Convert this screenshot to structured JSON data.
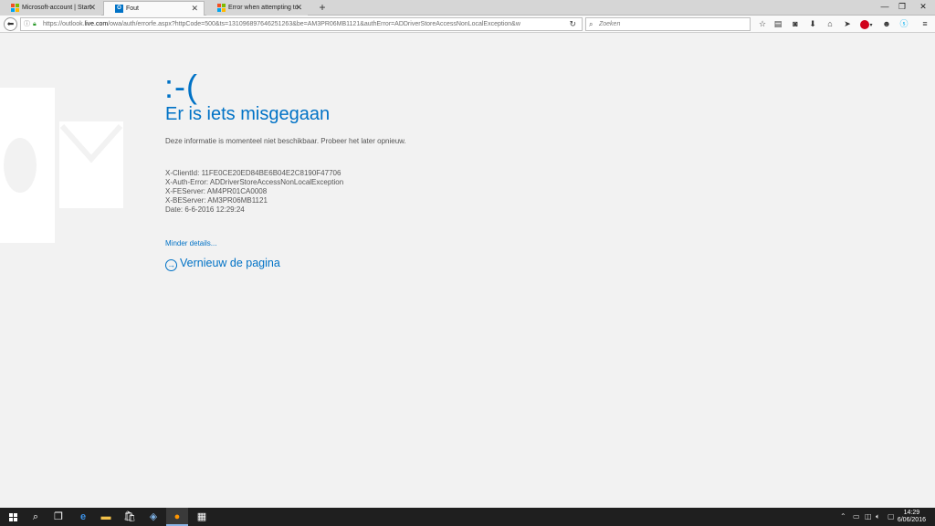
{
  "browser": {
    "tabs": [
      {
        "label": "Microsoft-account | Start",
        "active": false,
        "favicon": "microsoft-logo-icon"
      },
      {
        "label": "Fout",
        "active": true,
        "favicon": "outlook-icon"
      },
      {
        "label": "Error when attempting to ...",
        "active": false,
        "favicon": "microsoft-logo-icon"
      }
    ],
    "new_tab": "+",
    "window_controls": {
      "minimize": "—",
      "restore": "❐",
      "close": "✕"
    },
    "url_prefix": "https://outlook.",
    "url_domain": "live.com",
    "url_rest": "/owa/auth/errorfe.aspx?httpCode=500&ts=131096897646251263&be=AM3PR06MB1121&authError=ADDriverStoreAccessNonLocalException&w",
    "search_placeholder": "Zoeken"
  },
  "page": {
    "sad_face": ":-(",
    "title": "Er is iets misgegaan",
    "description": "Deze informatie is momenteel niet beschikbaar. Probeer het later opnieuw.",
    "diagnostics": [
      "X-ClientId: 11FE0CE20ED84BE6B04E2C8190F47706",
      "X-Auth-Error: ADDriverStoreAccessNonLocalException",
      "X-FEServer: AM4PR01CA0008",
      "X-BEServer: AM3PR06MB1121",
      "Date: 6-6-2016 12:29:24"
    ],
    "less_details": "Minder details...",
    "refresh": "Vernieuw de pagina"
  },
  "taskbar": {
    "time": "14:29",
    "date": "6/06/2016"
  },
  "colors": {
    "accent": "#0072c6",
    "page_bg": "#f2f2f2",
    "taskbar_bg": "#1f1f1f"
  }
}
